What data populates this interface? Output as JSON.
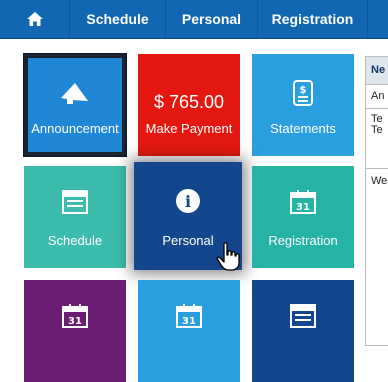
{
  "colors": {
    "nav_bg": "#1167b1",
    "announcement": "#1f87d6",
    "make_payment": "#e5180f",
    "statements": "#2a9fe0",
    "schedule": "#3cbcac",
    "personal": "#13468c",
    "registration": "#25b3a5",
    "tile_row3_col1": "#6b1d73",
    "tile_row3_col2": "#2a9fe0",
    "tile_row3_col3": "#13468c"
  },
  "nav": {
    "home_icon": "home-icon",
    "items": [
      "Schedule",
      "Personal",
      "Registration",
      ""
    ]
  },
  "tiles": {
    "announcement": {
      "label": "Announcement",
      "icon": "megaphone-icon"
    },
    "make_payment": {
      "amount": "$ 765.00",
      "label": "Make Payment"
    },
    "statements": {
      "label": "Statements",
      "icon": "document-dollar-icon"
    },
    "schedule": {
      "label": "Schedule",
      "icon": "calendar-icon"
    },
    "personal": {
      "label": "Personal",
      "icon": "info-icon"
    },
    "registration": {
      "label": "Registration",
      "icon": "calendar-31-icon",
      "day": "31"
    },
    "row3": [
      {
        "icon": "calendar-31-icon",
        "day": "31"
      },
      {
        "icon": "calendar-31-icon",
        "day": "31"
      },
      {
        "icon": "calendar-icon"
      }
    ]
  },
  "panel": {
    "header": "Ne",
    "row1": "An",
    "text_line1": "Te",
    "text_line2": "Te",
    "body": "We"
  }
}
